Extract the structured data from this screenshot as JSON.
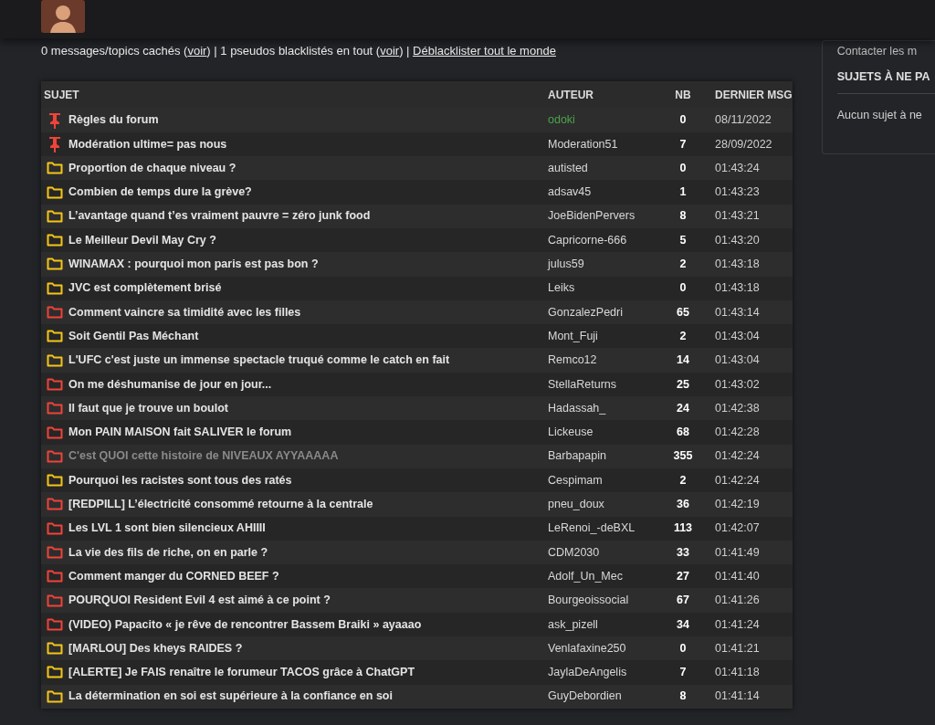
{
  "info_bar": {
    "parts": [
      {
        "kind": "text",
        "text": "0 messages/topics cachés ("
      },
      {
        "kind": "link",
        "text": "voir"
      },
      {
        "kind": "text",
        "text": ") | 1 pseudos blacklistés en tout ("
      },
      {
        "kind": "link",
        "text": "voir"
      },
      {
        "kind": "text",
        "text": ") | "
      },
      {
        "kind": "link",
        "text": "Déblacklister tout le monde"
      }
    ]
  },
  "table": {
    "columns": [
      "SUJET",
      "AUTEUR",
      "NB",
      "DERNIER MSG"
    ],
    "rows": [
      {
        "kind": "pinned",
        "subject": "Règles du forum",
        "author": "odoki",
        "moderator": true,
        "visited": false,
        "nb": "0",
        "last": "08/11/2022"
      },
      {
        "kind": "pinned",
        "subject": "Modération ultime= pas nous",
        "author": "Moderation51",
        "moderator": false,
        "visited": false,
        "nb": "7",
        "last": "28/09/2022"
      },
      {
        "kind": "normal",
        "subject": "Proportion de chaque niveau ?",
        "author": "autisted",
        "moderator": false,
        "visited": false,
        "nb": "0",
        "last": "01:43:24"
      },
      {
        "kind": "normal",
        "subject": "Combien de temps dure la grève?",
        "author": "adsav45",
        "moderator": false,
        "visited": false,
        "nb": "1",
        "last": "01:43:23"
      },
      {
        "kind": "normal",
        "subject": "L’avantage quand t’es vraiment pauvre = zéro junk food",
        "author": "JoeBidenPervers",
        "moderator": false,
        "visited": false,
        "nb": "8",
        "last": "01:43:21"
      },
      {
        "kind": "normal",
        "subject": "Le Meilleur Devil May Cry ?",
        "author": "Capricorne-666",
        "moderator": false,
        "visited": false,
        "nb": "5",
        "last": "01:43:20"
      },
      {
        "kind": "normal",
        "subject": "WINAMAX : pourquoi mon paris est pas bon ?",
        "author": "julus59",
        "moderator": false,
        "visited": false,
        "nb": "2",
        "last": "01:43:18"
      },
      {
        "kind": "normal",
        "subject": "JVC est complètement brisé",
        "author": "Leiks",
        "moderator": false,
        "visited": false,
        "nb": "0",
        "last": "01:43:18"
      },
      {
        "kind": "hot",
        "subject": "Comment vaincre sa timidité avec les filles",
        "author": "GonzalezPedri",
        "moderator": false,
        "visited": false,
        "nb": "65",
        "last": "01:43:14"
      },
      {
        "kind": "normal",
        "subject": "Soit Gentil Pas Méchant",
        "author": "Mont_Fuji",
        "moderator": false,
        "visited": false,
        "nb": "2",
        "last": "01:43:04"
      },
      {
        "kind": "normal",
        "subject": "L'UFC c'est juste un immense spectacle truqué comme le catch en fait",
        "author": "Remco12",
        "moderator": false,
        "visited": false,
        "nb": "14",
        "last": "01:43:04"
      },
      {
        "kind": "hot",
        "subject": "On me déshumanise de jour en jour...",
        "author": "StellaReturns",
        "moderator": false,
        "visited": false,
        "nb": "25",
        "last": "01:43:02"
      },
      {
        "kind": "hot",
        "subject": "Il faut que je trouve un boulot",
        "author": "Hadassah_",
        "moderator": false,
        "visited": false,
        "nb": "24",
        "last": "01:42:38"
      },
      {
        "kind": "hot",
        "subject": "Mon PAIN MAISON fait SALIVER le forum",
        "author": "Lickeuse",
        "moderator": false,
        "visited": false,
        "nb": "68",
        "last": "01:42:28"
      },
      {
        "kind": "hot",
        "subject": "C'est QUOI cette histoire de NIVEAUX AYYAAAAA",
        "author": "Barbapapin",
        "moderator": false,
        "visited": true,
        "nb": "355",
        "last": "01:42:24"
      },
      {
        "kind": "normal",
        "subject": "Pourquoi les racistes sont tous des ratés",
        "author": "Cespimam",
        "moderator": false,
        "visited": false,
        "nb": "2",
        "last": "01:42:24"
      },
      {
        "kind": "hot",
        "subject": "[REDPILL] L’électricité consommé retourne à la centrale",
        "author": "pneu_doux",
        "moderator": false,
        "visited": false,
        "nb": "36",
        "last": "01:42:19"
      },
      {
        "kind": "hot",
        "subject": "Les LVL 1 sont bien silencieux AHIIII",
        "author": "LeRenoi_-deBXL",
        "moderator": false,
        "visited": false,
        "nb": "113",
        "last": "01:42:07"
      },
      {
        "kind": "hot",
        "subject": "La vie des fils de riche, on en parle ?",
        "author": "CDM2030",
        "moderator": false,
        "visited": false,
        "nb": "33",
        "last": "01:41:49"
      },
      {
        "kind": "hot",
        "subject": "Comment manger du CORNED BEEF ?",
        "author": "Adolf_Un_Mec",
        "moderator": false,
        "visited": false,
        "nb": "27",
        "last": "01:41:40"
      },
      {
        "kind": "hot",
        "subject": "POURQUOI Resident Evil 4 est aimé à ce point ?",
        "author": "Bourgeoissocial",
        "moderator": false,
        "visited": false,
        "nb": "67",
        "last": "01:41:26"
      },
      {
        "kind": "hot",
        "subject": "(VIDEO) Papacito «  je rêve de rencontrer Bassem Braiki » ayaaao",
        "author": "ask_pizell",
        "moderator": false,
        "visited": false,
        "nb": "34",
        "last": "01:41:24"
      },
      {
        "kind": "normal",
        "subject": "[MARLOU] Des kheys RAIDES ?",
        "author": "Venlafaxine250",
        "moderator": false,
        "visited": false,
        "nb": "0",
        "last": "01:41:21"
      },
      {
        "kind": "normal",
        "subject": "[ALERTE] Je FAIS renaître le forumeur TACOS grâce à ChatGPT",
        "author": "JaylaDeAngelis",
        "moderator": false,
        "visited": false,
        "nb": "7",
        "last": "01:41:18"
      },
      {
        "kind": "normal",
        "subject": "La détermination en soi est supérieure à la confiance en soi",
        "author": "GuyDebordien",
        "moderator": false,
        "visited": false,
        "nb": "8",
        "last": "01:41:14"
      }
    ]
  },
  "sidebar": {
    "link": "Contacter les m",
    "title": "SUJETS À NE PA",
    "text": "Aucun sujet à ne"
  }
}
